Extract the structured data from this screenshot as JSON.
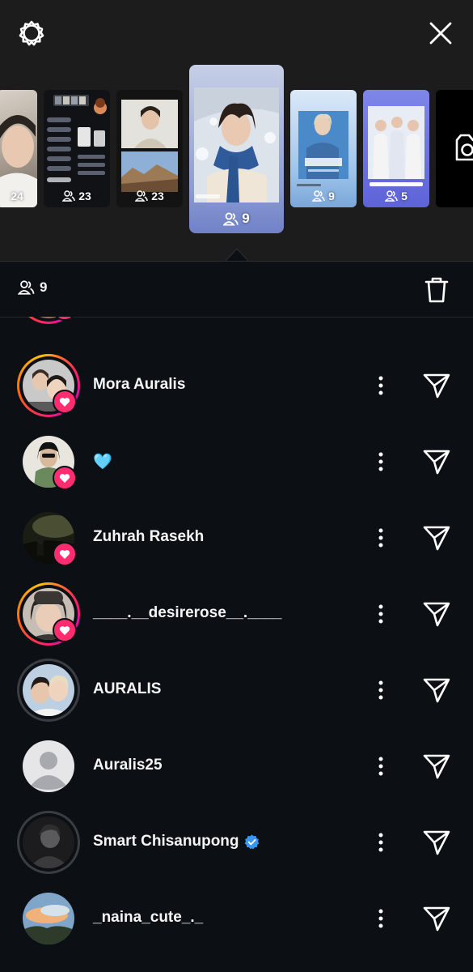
{
  "header": {
    "settings_icon": "gear-icon",
    "close_icon": "close-icon"
  },
  "stories": [
    {
      "count": "24"
    },
    {
      "count": "23"
    },
    {
      "count": "23"
    },
    {
      "count": "9",
      "selected": true
    },
    {
      "count": "9"
    },
    {
      "count": "5"
    },
    {
      "icon": "camera-icon"
    }
  ],
  "viewer_bar": {
    "count": "9",
    "delete_icon": "trash-icon"
  },
  "viewers": [
    {
      "name": "Mora Auralis",
      "ring": "story",
      "liked": true
    },
    {
      "name": "🩵",
      "ring": "none",
      "liked": true
    },
    {
      "name": "Zuhrah Rasekh",
      "ring": "none",
      "liked": true
    },
    {
      "name": "____.__desirerose__.____",
      "ring": "story",
      "liked": true
    },
    {
      "name": "AURALIS",
      "ring": "seen",
      "liked": false
    },
    {
      "name": "Auralis25",
      "ring": "none",
      "liked": false
    },
    {
      "name": "Smart Chisanupong",
      "ring": "seen",
      "liked": false,
      "verified": true
    },
    {
      "name": "_naina_cute_._",
      "ring": "none",
      "liked": false
    }
  ],
  "colors": {
    "like_badge": "#ff2d6f",
    "verified": "#3897f0",
    "background": "#0c0f14",
    "top_background": "#1c1c1c"
  }
}
